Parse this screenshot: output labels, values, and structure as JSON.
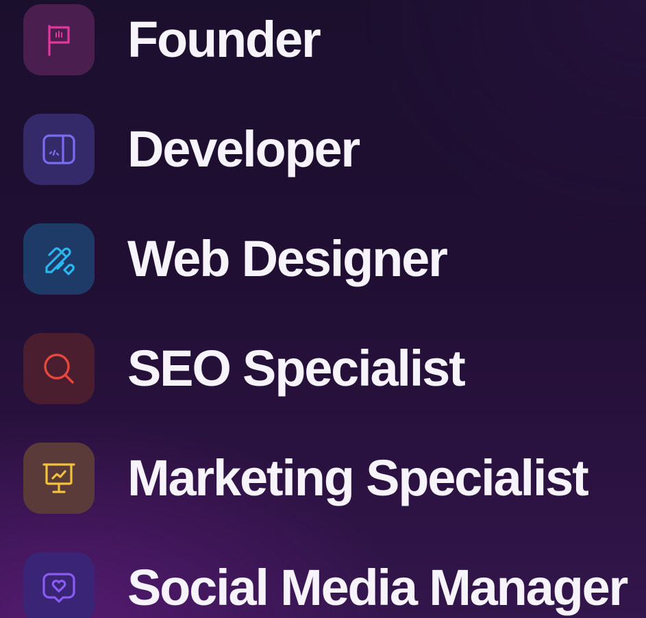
{
  "roles": [
    {
      "label": "Founder",
      "icon": "flag-icon",
      "tile_color": "#4a1e4f",
      "icon_color": "#e0399b"
    },
    {
      "label": "Developer",
      "icon": "code-window-icon",
      "tile_color": "#342a6a",
      "icon_color": "#7a6cf0"
    },
    {
      "label": "Web Designer",
      "icon": "pen-ruler-icon",
      "tile_color": "#1d3b66",
      "icon_color": "#2bb6f0"
    },
    {
      "label": "SEO Specialist",
      "icon": "search-icon",
      "tile_color": "#4a1e2e",
      "icon_color": "#e8473e"
    },
    {
      "label": "Marketing Specialist",
      "icon": "presentation-board-icon",
      "tile_color": "#5a3b3a",
      "icon_color": "#f3c23a"
    },
    {
      "label": "Social Media Manager",
      "icon": "chat-heart-icon",
      "tile_color": "#3a2475",
      "icon_color": "#8a5cf2"
    }
  ]
}
